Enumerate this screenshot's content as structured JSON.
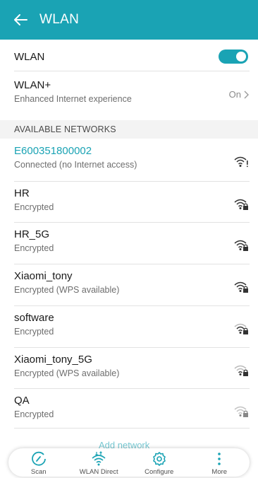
{
  "header": {
    "title": "WLAN"
  },
  "wlan_toggle": {
    "label": "WLAN",
    "state": "on"
  },
  "wlan_plus": {
    "label": "WLAN+",
    "subtitle": "Enhanced Internet experience",
    "value": "On"
  },
  "section_title": "AVAILABLE NETWORKS",
  "networks": [
    {
      "name": "E600351800002",
      "status": "Connected (no Internet access)"
    },
    {
      "name": "HR",
      "status": "Encrypted"
    },
    {
      "name": "HR_5G",
      "status": "Encrypted"
    },
    {
      "name": "Xiaomi_tony",
      "status": "Encrypted (WPS available)"
    },
    {
      "name": "software",
      "status": "Encrypted"
    },
    {
      "name": "Xiaomi_tony_5G",
      "status": "Encrypted (WPS available)"
    },
    {
      "name": "QA",
      "status": "Encrypted"
    }
  ],
  "add_network_label": "Add network",
  "bottom_bar": [
    {
      "label": "Scan",
      "icon": "scan-icon"
    },
    {
      "label": "WLAN Direct",
      "icon": "wlan-direct-icon"
    },
    {
      "label": "Configure",
      "icon": "gear-icon"
    },
    {
      "label": "More",
      "icon": "more-icon"
    }
  ],
  "colors": {
    "accent": "#1aa3b4"
  }
}
